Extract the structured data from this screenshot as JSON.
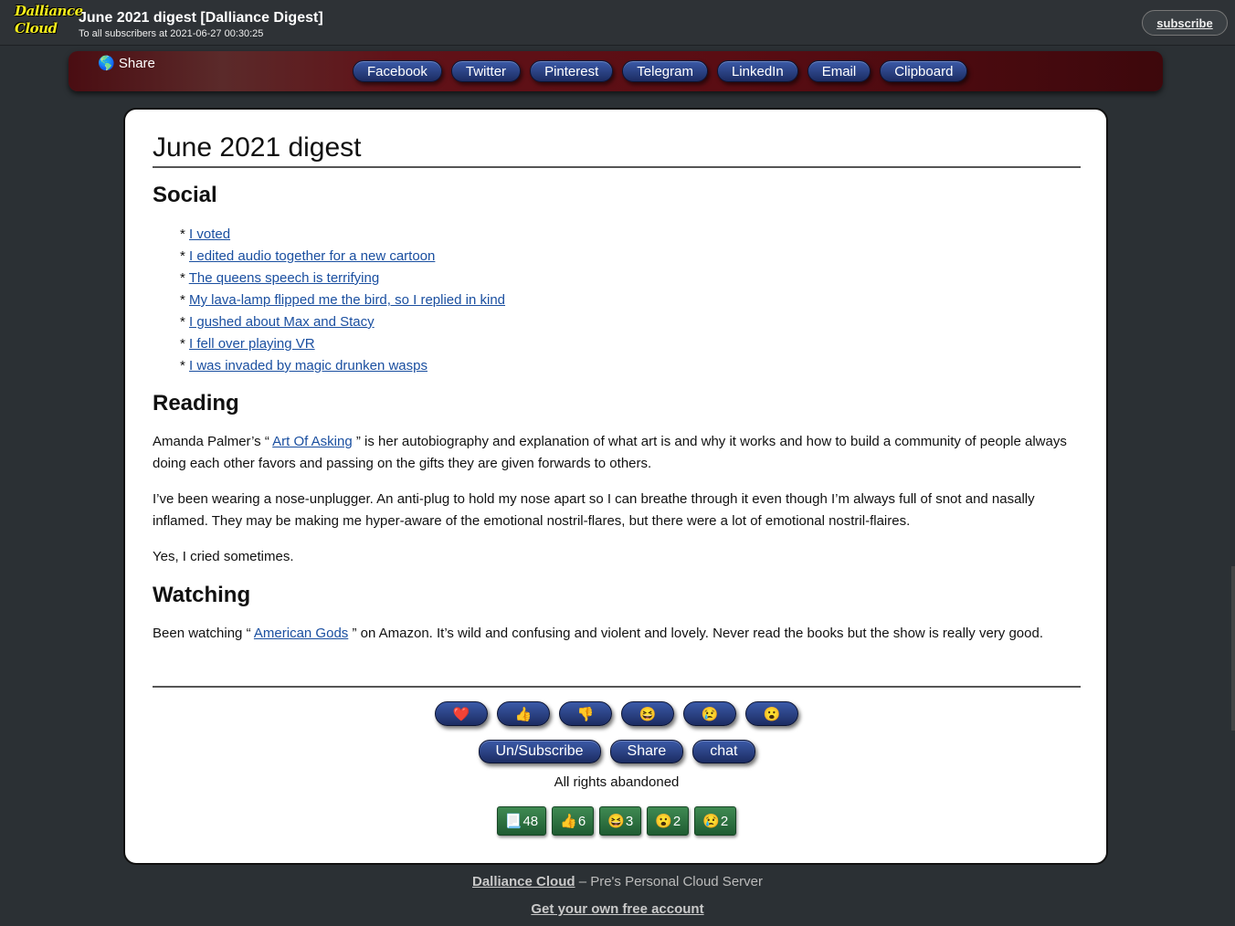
{
  "header": {
    "logo_text_1": "Dalliance",
    "logo_text_2": "Cloud",
    "title": "June 2021 digest [Dalliance Digest]",
    "subtitle": "To all subscribers at 2021-06-27 00:30:25",
    "subscribe_label": "subscribe"
  },
  "sharebar": {
    "label": "🌎 Share",
    "buttons": [
      "Facebook",
      "Twitter",
      "Pinterest",
      "Telegram",
      "LinkedIn",
      "Email",
      "Clipboard"
    ]
  },
  "article": {
    "title": "June 2021 digest",
    "sections": {
      "social": {
        "heading": "Social",
        "items": [
          "I voted",
          "I edited audio together for a new cartoon",
          "The queens speech is terrifying",
          "My lava-lamp flipped me the bird, so I replied in kind",
          "I gushed about Max and Stacy",
          "I fell over playing VR",
          "I was invaded by magic drunken wasps"
        ]
      },
      "reading": {
        "heading": "Reading",
        "p1_before": "Amanda Palmer’s “ ",
        "p1_link": "Art Of Asking",
        "p1_after": " ” is her autobiography and explanation of what art is and why it works and how to build a community of people always doing each other favors and passing on the gifts they are given forwards to others.",
        "p2": "I’ve been wearing a nose-unplugger. An anti-plug to hold my nose apart so I can breathe through it even though I’m always full of snot and nasally inflamed. They may be making me hyper-aware of the emotional nostril-flares, but there were a lot of emotional nostril-flaires.",
        "p3": "Yes, I cried sometimes."
      },
      "watching": {
        "heading": "Watching",
        "p1_before": "Been watching “ ",
        "p1_link": "American Gods",
        "p1_after": " ” on Amazon. It’s wild and confusing and violent and lovely. Never read the books but the show is really very good."
      }
    }
  },
  "reactions": [
    "❤️",
    "👍",
    "👎",
    "😆",
    "😢",
    "😮"
  ],
  "actions": {
    "unsubscribe": "Un/Subscribe",
    "share": "Share",
    "chat": "chat"
  },
  "rights": "All rights abandoned",
  "stats": [
    {
      "icon": "📃",
      "count": "48"
    },
    {
      "icon": "👍",
      "count": "6"
    },
    {
      "icon": "😆",
      "count": "3"
    },
    {
      "icon": "😮",
      "count": "2"
    },
    {
      "icon": "😢",
      "count": "2"
    }
  ],
  "footer": {
    "site_link": "Dalliance Cloud",
    "site_desc": " – Pre's Personal Cloud Server",
    "account_link": "Get your own free account"
  },
  "colors": {
    "background": "#2b3034",
    "logo": "#f3ec1c",
    "button_blue": "#1c2c62",
    "stat_green": "#1f5c32",
    "link": "#1a4fa0"
  }
}
